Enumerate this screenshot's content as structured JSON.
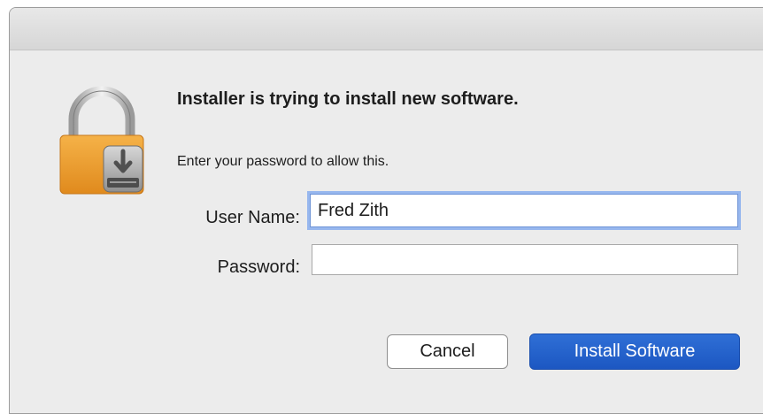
{
  "dialog": {
    "heading": "Installer is trying to install new software.",
    "message": "Enter your password to allow this.",
    "icon": "lock-icon"
  },
  "fields": {
    "username_label": "User Name:",
    "username_value": "Fred Zith",
    "password_label": "Password:",
    "password_value": ""
  },
  "buttons": {
    "cancel_label": "Cancel",
    "install_label": "Install Software"
  },
  "colors": {
    "accent": "#1f5cc6",
    "lock_body": "#e99a2c",
    "focus_ring": "#97b7ee"
  }
}
